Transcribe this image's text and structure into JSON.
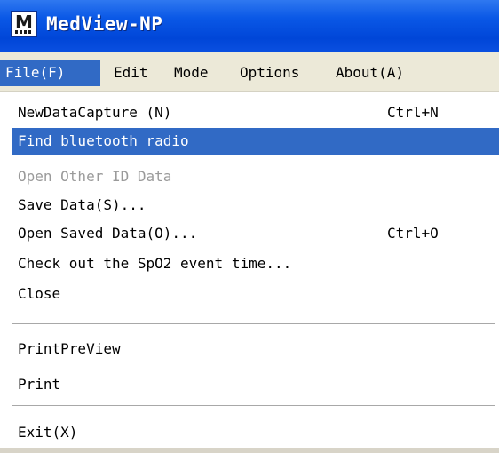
{
  "window": {
    "title": "MedView-NP",
    "icon": "app-logo-icon"
  },
  "menubar": {
    "items": [
      {
        "label": "File(F)",
        "active": true
      },
      {
        "label": "Edit"
      },
      {
        "label": "Mode"
      },
      {
        "label": "Options"
      },
      {
        "label": "About(A)"
      }
    ]
  },
  "file_menu": {
    "items": [
      {
        "label": "NewDataCapture (N)",
        "shortcut": "Ctrl+N"
      },
      {
        "label": "Find bluetooth radio",
        "highlighted": true
      },
      {
        "label": "Open Other ID Data",
        "disabled": true
      },
      {
        "label": "Save Data(S)..."
      },
      {
        "label": "Open Saved Data(O)...",
        "shortcut": "Ctrl+O"
      },
      {
        "label": "Check out the SpO2 event time..."
      },
      {
        "label": "Close"
      },
      {
        "label": "PrintPreView"
      },
      {
        "label": "Print"
      },
      {
        "label": "Exit(X)"
      }
    ]
  },
  "colors": {
    "titlebar": "#0a58e6",
    "highlight": "#316ac5",
    "menubar_bg": "#ece9d8",
    "disabled_text": "#9a9a9a"
  }
}
